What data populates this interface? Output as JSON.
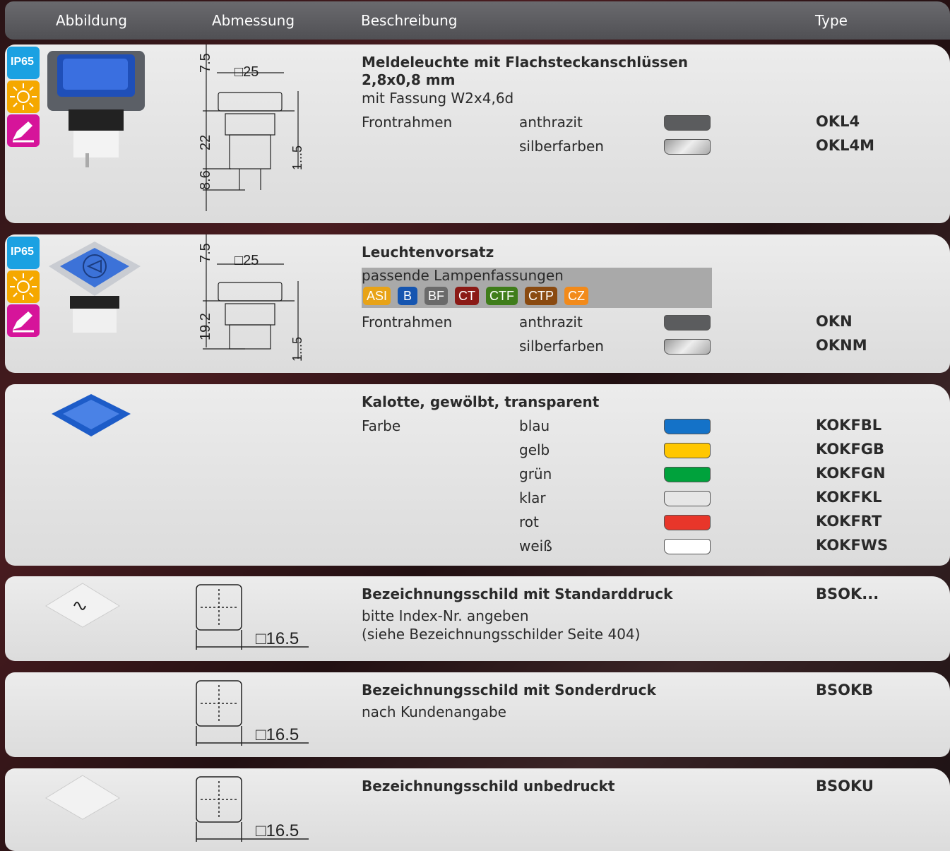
{
  "header": {
    "col_image": "Abbildung",
    "col_dimension": "Abmessung",
    "col_description": "Beschreibung",
    "col_type": "Type"
  },
  "colors": {
    "anthrazit": "#5b5c5e",
    "blau": "#1472c8",
    "gelb": "#ffc700",
    "gruen": "#00a23c",
    "klar": "#e6e6e6",
    "rot": "#e8362a",
    "weiss": "#ffffff"
  },
  "badges": {
    "ip": "IP65",
    "light": "sun-icon",
    "pen": "pen-icon"
  },
  "row1": {
    "title_line1": "Meldeleuchte mit Flachsteckanschlüssen",
    "title_line2": "2,8x0,8 mm",
    "subtitle": "mit Fassung W2x4,6d",
    "label": "Frontrahmen",
    "variants": [
      {
        "name": "anthrazit",
        "type": "OKL4"
      },
      {
        "name": "silberfarben",
        "type": "OKL4M"
      }
    ],
    "dims": {
      "top": "7.5",
      "width": "□25",
      "body": "22",
      "pins": "8.6",
      "panel": "1...5"
    }
  },
  "row2": {
    "title": "Leuchtenvorsatz",
    "fits_label": "passende Lampenfassungen",
    "tags": [
      {
        "t": "ASI",
        "c": "#e8a317"
      },
      {
        "t": "B",
        "c": "#1555b0"
      },
      {
        "t": "BF",
        "c": "#6a6a6a"
      },
      {
        "t": "CT",
        "c": "#8b1a16"
      },
      {
        "t": "CTF",
        "c": "#3f7d1a"
      },
      {
        "t": "CTP",
        "c": "#8a4a10"
      },
      {
        "t": "CZ",
        "c": "#f28a1a"
      }
    ],
    "label": "Frontrahmen",
    "variants": [
      {
        "name": "anthrazit",
        "type": "OKN"
      },
      {
        "name": "silberfarben",
        "type": "OKNM"
      }
    ],
    "dims": {
      "top": "7.5",
      "width": "□25",
      "body": "19.2",
      "panel": "1...5"
    }
  },
  "row3": {
    "title": "Kalotte, gewölbt, transparent",
    "label": "Farbe",
    "variants": [
      {
        "name": "blau",
        "type": "KOKFBL"
      },
      {
        "name": "gelb",
        "type": "KOKFGB"
      },
      {
        "name": "grün",
        "type": "KOKFGN"
      },
      {
        "name": "klar",
        "type": "KOKFKL"
      },
      {
        "name": "rot",
        "type": "KOKFRT"
      },
      {
        "name": "weiß",
        "type": "KOKFWS"
      }
    ]
  },
  "row4": {
    "title": "Bezeichnungsschild mit Standarddruck",
    "line1": "bitte Index-Nr. angeben",
    "line2": "(siehe Bezeichnungsschilder Seite 404)",
    "type": "BSOK...",
    "dim": "□16.5"
  },
  "row5": {
    "title": "Bezeichnungsschild mit Sonderdruck",
    "line1": "nach Kundenangabe",
    "type": "BSOKB",
    "dim": "□16.5"
  },
  "row6": {
    "title": "Bezeichnungsschild unbedruckt",
    "type": "BSOKU",
    "dim": "□16.5"
  }
}
